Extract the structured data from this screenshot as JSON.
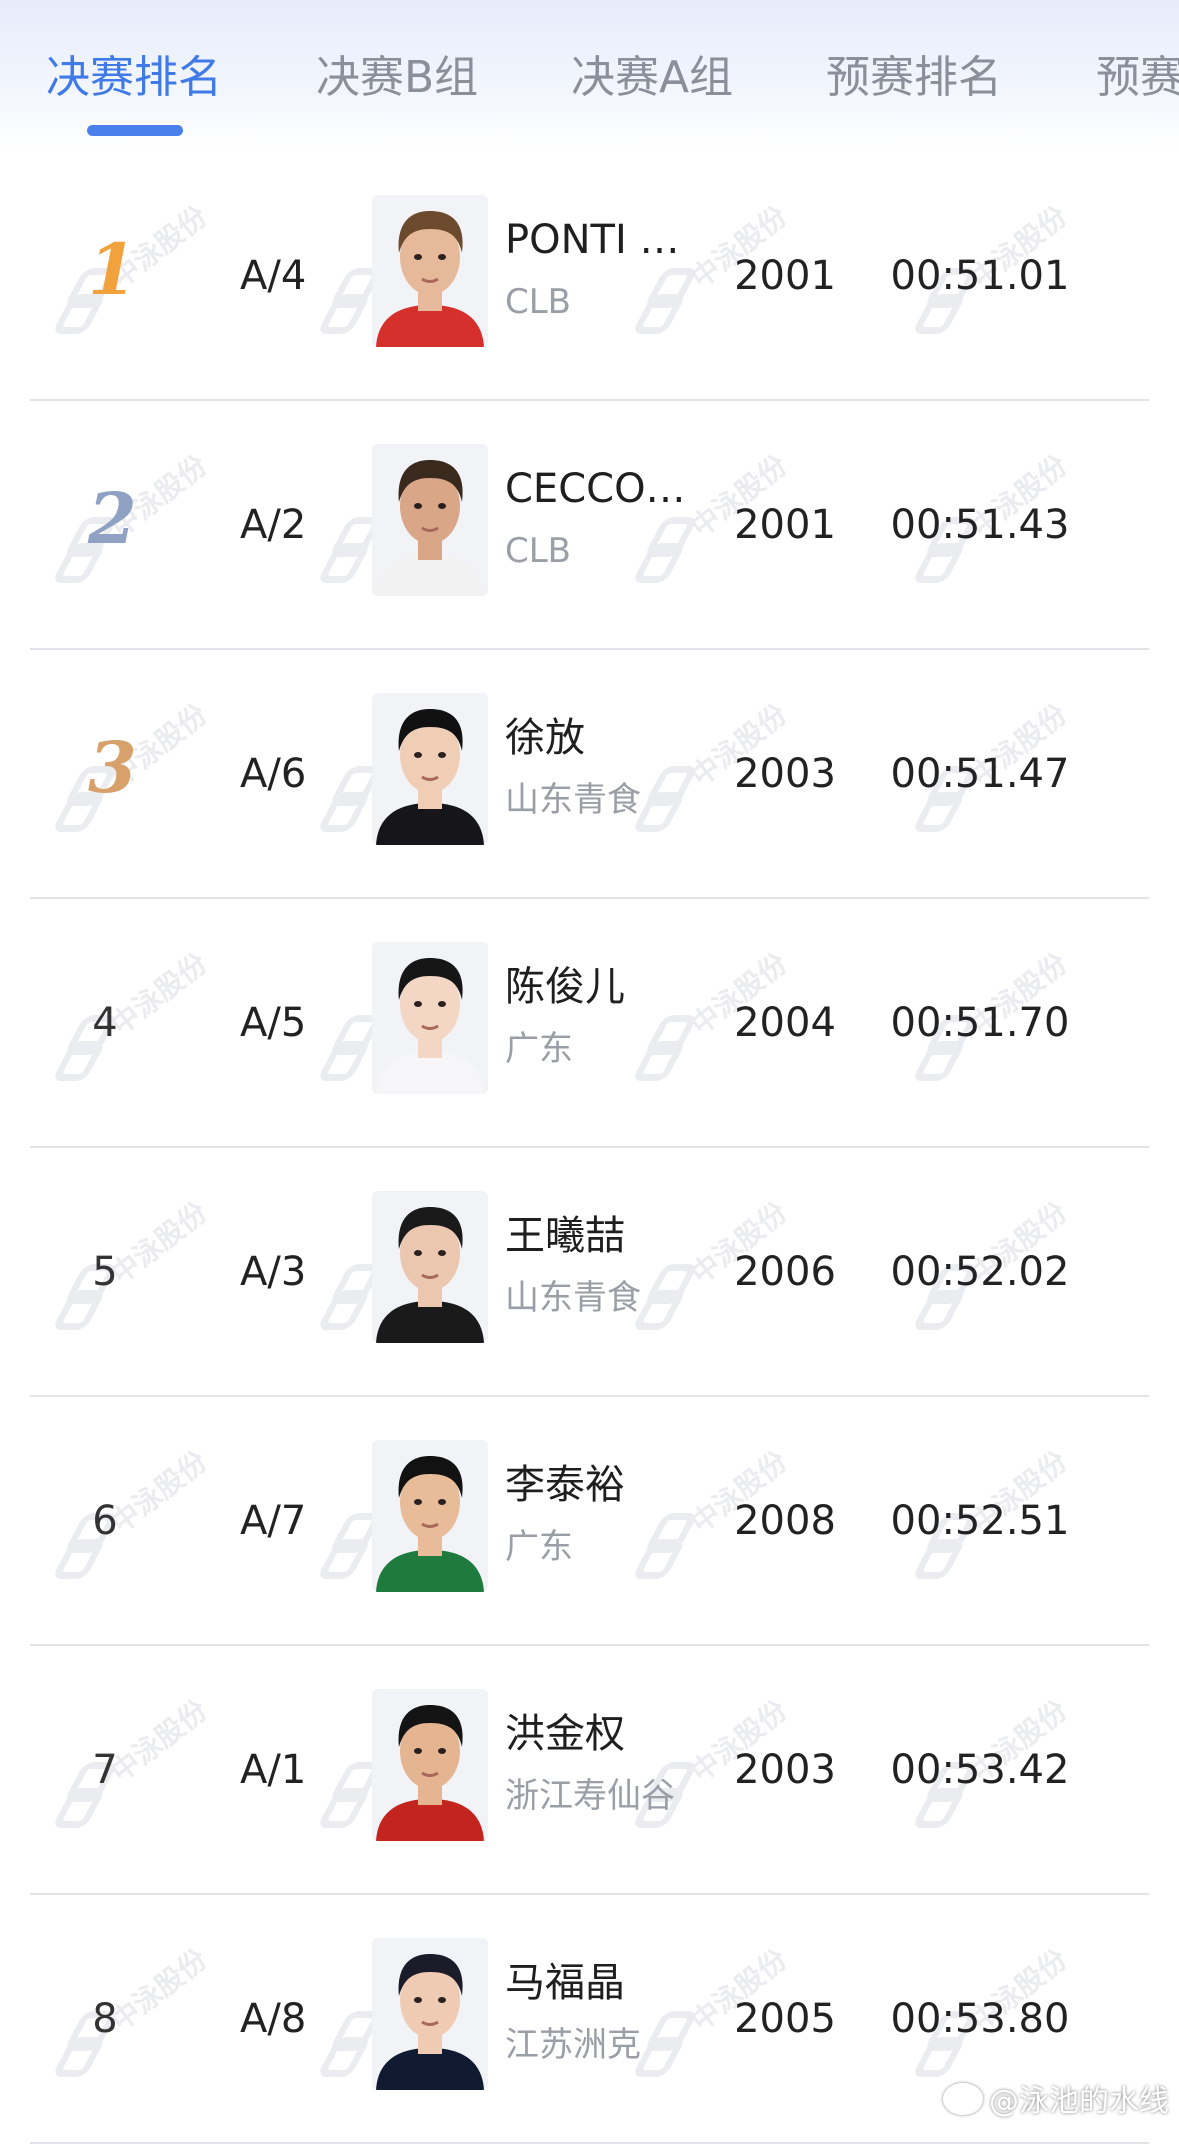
{
  "tabs": [
    {
      "label": "决赛排名",
      "active": true
    },
    {
      "label": "决赛B组",
      "active": false
    },
    {
      "label": "决赛A组",
      "active": false
    },
    {
      "label": "预赛排名",
      "active": false
    },
    {
      "label": "预赛",
      "active": false
    }
  ],
  "colors": {
    "accent": "#3f7ae8",
    "gold": "#f2a23c",
    "silver": "#8fa2c4",
    "bronze": "#d8a06b",
    "divider": "#e1e3e8"
  },
  "watermark": {
    "text": "中泳股份",
    "icon": "zhongyong-logo-icon"
  },
  "rows": [
    {
      "rank": "1",
      "medal": "gold-medal-icon",
      "lane": "A/4",
      "name": "PONTI …",
      "team": "CLB",
      "year": "2001",
      "time": "00:51.01"
    },
    {
      "rank": "2",
      "medal": "silver-medal-icon",
      "lane": "A/2",
      "name": "CECCO…",
      "team": "CLB",
      "year": "2001",
      "time": "00:51.43"
    },
    {
      "rank": "3",
      "medal": "bronze-medal-icon",
      "lane": "A/6",
      "name": "徐放",
      "team": "山东青食",
      "year": "2003",
      "time": "00:51.47"
    },
    {
      "rank": "4",
      "medal": null,
      "lane": "A/5",
      "name": "陈俊儿",
      "team": "广东",
      "year": "2004",
      "time": "00:51.70"
    },
    {
      "rank": "5",
      "medal": null,
      "lane": "A/3",
      "name": "王曦喆",
      "team": "山东青食",
      "year": "2006",
      "time": "00:52.02"
    },
    {
      "rank": "6",
      "medal": null,
      "lane": "A/7",
      "name": "李泰裕",
      "team": "广东",
      "year": "2008",
      "time": "00:52.51"
    },
    {
      "rank": "7",
      "medal": null,
      "lane": "A/1",
      "name": "洪金权",
      "team": "浙江寿仙谷",
      "year": "2003",
      "time": "00:53.42"
    },
    {
      "rank": "8",
      "medal": null,
      "lane": "A/8",
      "name": "马福晶",
      "team": "江苏洲克",
      "year": "2005",
      "time": "00:53.80"
    }
  ],
  "credit": {
    "text": "@泳池的水线",
    "icon": "weibo-icon"
  }
}
